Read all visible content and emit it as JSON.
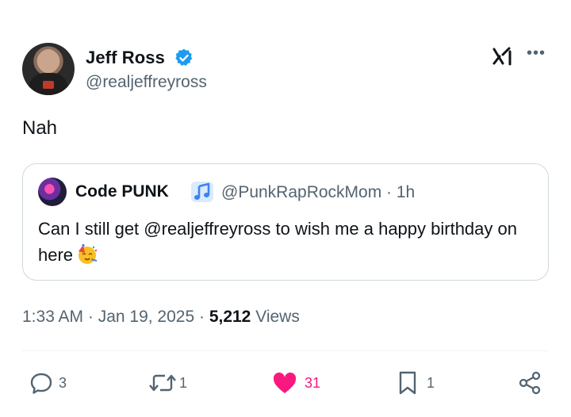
{
  "author": {
    "name": "Jeff Ross",
    "handle": "@realjeffreyross",
    "verified": true
  },
  "tweet": {
    "text": "Nah"
  },
  "quoted": {
    "name": "Code PUNK",
    "handle_time": "@PunkRapRockMom · 1h",
    "text": "Can I still get @realjeffreyross to wish me a happy birthday on here",
    "emoji": "partying-face-emoji"
  },
  "meta": {
    "time_date": "1:33 AM · Jan 19, 2025 · ",
    "views_count": "5,212",
    "views_label": " Views"
  },
  "actions": {
    "replies": "3",
    "reposts": "1",
    "likes": "31",
    "bookmarks": "1"
  },
  "colors": {
    "verified_blue": "#1d9bf0",
    "like_pink": "#f91880",
    "secondary_text": "#536471",
    "music_note_blue": "#3b82f6"
  }
}
